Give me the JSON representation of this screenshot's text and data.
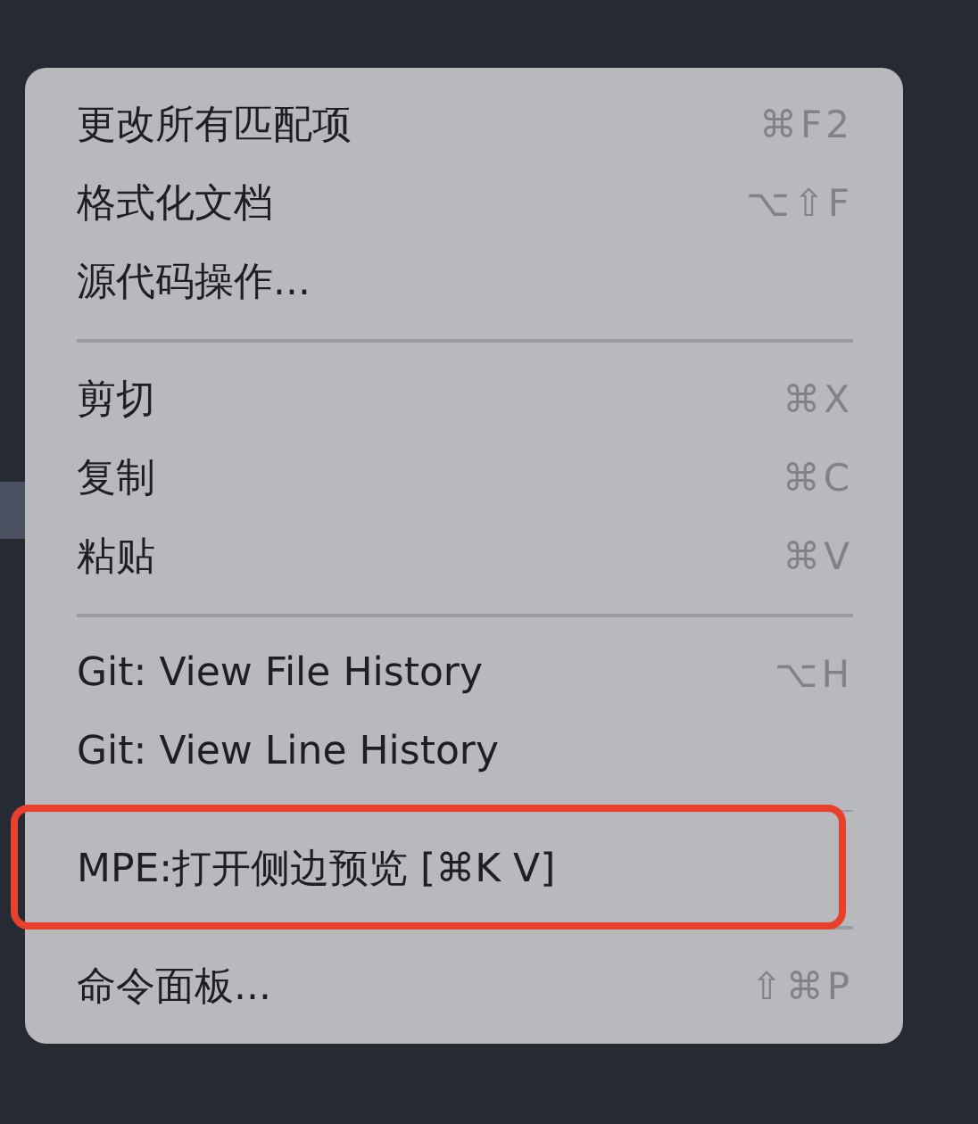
{
  "context_menu": {
    "groups": [
      {
        "items": [
          {
            "label": "更改所有匹配项",
            "shortcut": "⌘F2",
            "highlighted": false
          },
          {
            "label": "格式化文档",
            "shortcut": "⌥⇧F",
            "highlighted": false
          },
          {
            "label": "源代码操作...",
            "highlighted": false
          }
        ]
      },
      {
        "items": [
          {
            "label": "剪切",
            "shortcut": "⌘X",
            "highlighted": false
          },
          {
            "label": "复制",
            "shortcut": "⌘C",
            "highlighted": false
          },
          {
            "label": "粘贴",
            "shortcut": "⌘V",
            "highlighted": false
          }
        ]
      },
      {
        "items": [
          {
            "label": "Git: View File History",
            "shortcut": "⌥H",
            "highlighted": false
          },
          {
            "label": "Git: View Line History",
            "highlighted": false
          }
        ]
      },
      {
        "items": [
          {
            "label": "MPE:打开侧边预览 [⌘K V]",
            "highlighted": true
          }
        ]
      },
      {
        "items": [
          {
            "label": "命令面板...",
            "shortcut": "⇧⌘P",
            "highlighted": false
          }
        ]
      }
    ]
  }
}
